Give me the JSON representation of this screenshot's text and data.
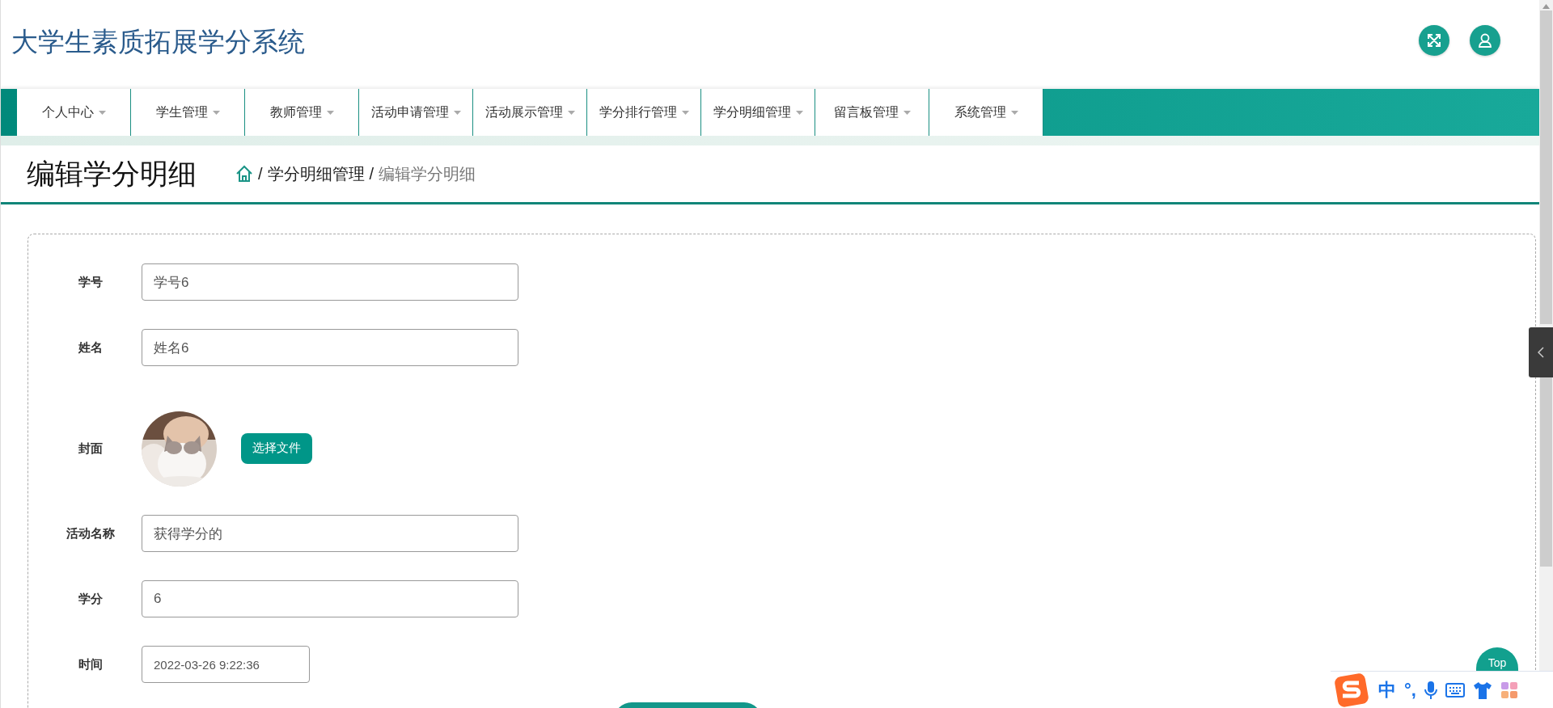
{
  "header": {
    "title": "大学生素质拓展学分系统"
  },
  "nav": {
    "items": [
      {
        "label": "个人中心"
      },
      {
        "label": "学生管理"
      },
      {
        "label": "教师管理"
      },
      {
        "label": "活动申请管理"
      },
      {
        "label": "活动展示管理"
      },
      {
        "label": "学分排行管理"
      },
      {
        "label": "学分明细管理"
      },
      {
        "label": "留言板管理"
      },
      {
        "label": "系统管理"
      }
    ]
  },
  "page": {
    "title": "编辑学分明细",
    "breadcrumb": [
      {
        "separator": "/",
        "label": "学分明细管理",
        "current": false
      },
      {
        "separator": "/",
        "label": "编辑学分明细",
        "current": true
      }
    ]
  },
  "form": {
    "fields": [
      {
        "kind": "text",
        "label": "学号",
        "value": "学号6"
      },
      {
        "kind": "text",
        "label": "姓名",
        "value": "姓名6"
      },
      {
        "label": "封面",
        "button": "选择文件"
      },
      {
        "kind": "text",
        "label": "活动名称",
        "value": "获得学分的"
      },
      {
        "kind": "text",
        "label": "学分",
        "value": "6"
      },
      {
        "kind": "datetime",
        "label": "时间",
        "value": "2022-03-26 9:22:36"
      }
    ]
  },
  "top_button": {
    "label": "Top"
  },
  "ime_bar": {
    "items": [
      "中",
      "°,"
    ]
  }
}
